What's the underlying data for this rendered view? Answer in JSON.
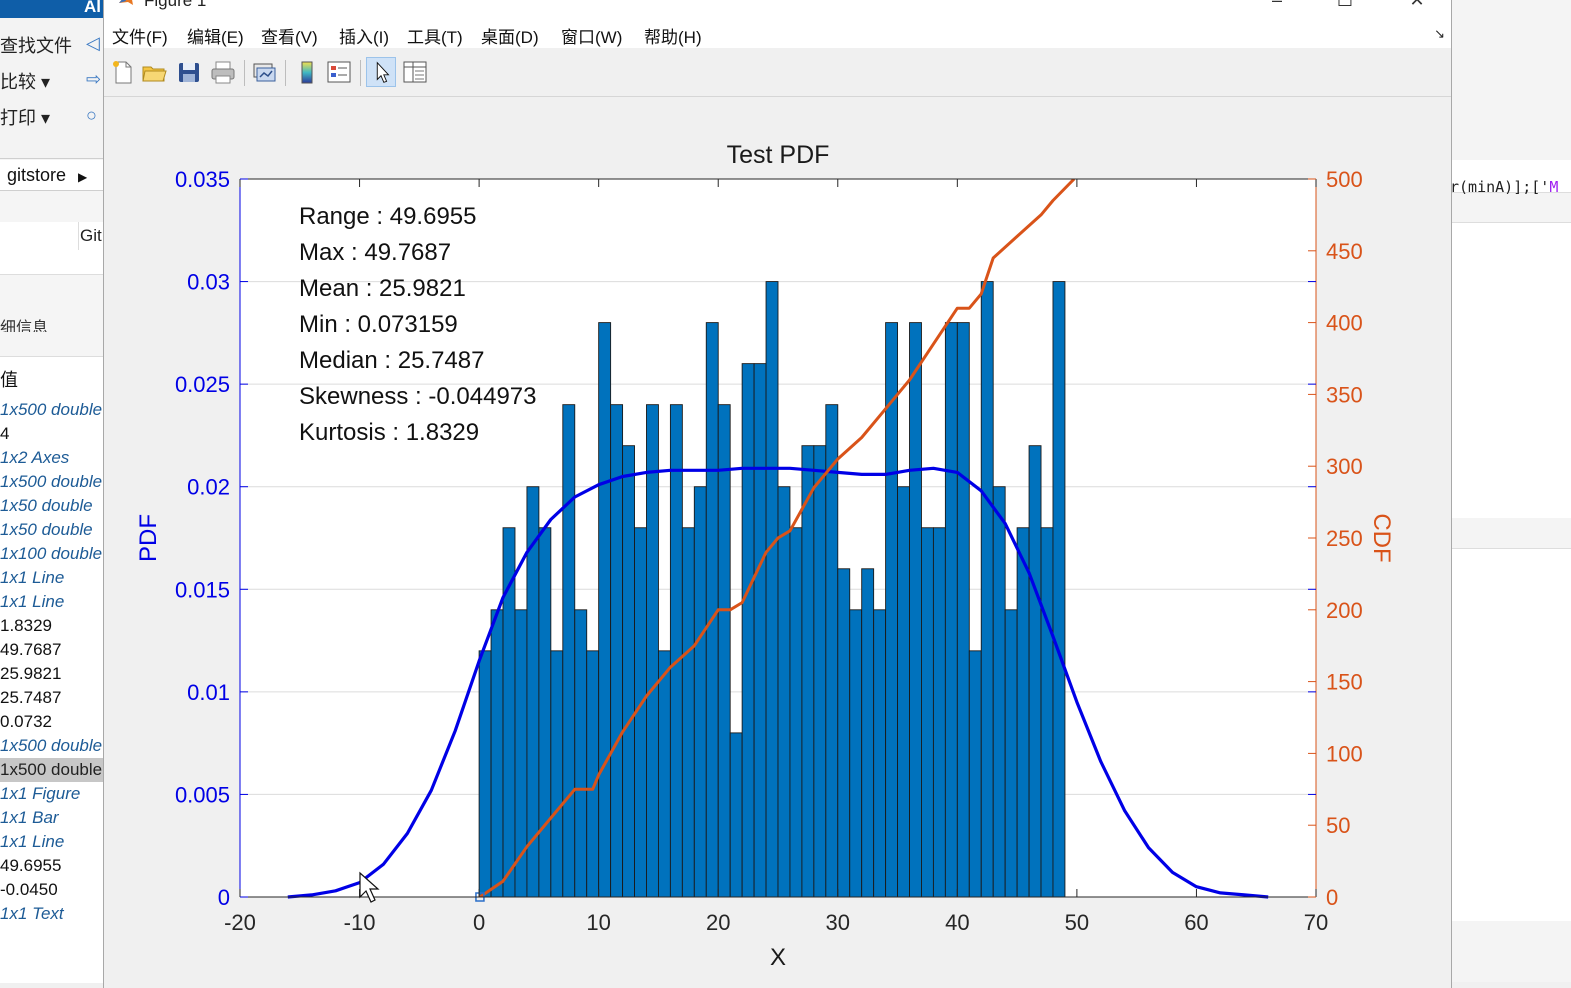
{
  "background": {
    "app_title_fragment": "Al",
    "ribbon_items": [
      "查找文件",
      "比较",
      "打印"
    ],
    "breadcrumb": "gitstore",
    "column_fragment": "Git",
    "section_fragment": "细信息",
    "value_header": "值",
    "workspace_values": [
      {
        "text": "1x500 double",
        "style": "link"
      },
      {
        "text": "4",
        "style": "plain"
      },
      {
        "text": "1x2 Axes",
        "style": "link"
      },
      {
        "text": "1x500 double",
        "style": "link"
      },
      {
        "text": "1x50 double",
        "style": "link"
      },
      {
        "text": "1x50 double",
        "style": "link"
      },
      {
        "text": "1x100 double",
        "style": "link"
      },
      {
        "text": "1x1 Line",
        "style": "link"
      },
      {
        "text": "1x1 Line",
        "style": "link"
      },
      {
        "text": "1.8329",
        "style": "plain"
      },
      {
        "text": "49.7687",
        "style": "plain"
      },
      {
        "text": "25.9821",
        "style": "plain"
      },
      {
        "text": "25.7487",
        "style": "plain"
      },
      {
        "text": "0.0732",
        "style": "plain"
      },
      {
        "text": "1x500 double",
        "style": "link"
      },
      {
        "text": "1x500 double",
        "style": "selected"
      },
      {
        "text": "1x1 Figure",
        "style": "link"
      },
      {
        "text": "1x1 Bar",
        "style": "link"
      },
      {
        "text": "1x1 Line",
        "style": "link"
      },
      {
        "text": "49.6955",
        "style": "plain"
      },
      {
        "text": "-0.0450",
        "style": "plain"
      },
      {
        "text": "1x1 Text",
        "style": "link"
      }
    ],
    "code_fragment_prefix": "r(minA)];['",
    "code_fragment_string": "M"
  },
  "figure": {
    "title": "Figure 1",
    "menu": [
      "文件(F)",
      "编辑(E)",
      "查看(V)",
      "插入(I)",
      "工具(T)",
      "桌面(D)",
      "窗口(W)",
      "帮助(H)"
    ],
    "toolbar_icons": [
      "new-figure-icon",
      "open-file-icon",
      "save-icon",
      "print-icon",
      "link-plot-icon",
      "colorbar-icon",
      "legend-icon",
      "edit-plot-icon",
      "property-inspector-icon"
    ]
  },
  "chart_data": {
    "type": "bar",
    "title": "Test PDF",
    "xlabel": "X",
    "ylabel_left": "PDF",
    "ylabel_right": "CDF",
    "xlim": [
      -20,
      70
    ],
    "ylim_left": [
      0,
      0.035
    ],
    "ylim_right": [
      0,
      500
    ],
    "xticks": [
      "-20",
      "-10",
      "0",
      "10",
      "20",
      "30",
      "40",
      "50",
      "60",
      "70"
    ],
    "yticks_left": [
      "0",
      "0.005",
      "0.01",
      "0.015",
      "0.02",
      "0.025",
      "0.03",
      "0.035"
    ],
    "yticks_right": [
      "0",
      "50",
      "100",
      "150",
      "200",
      "250",
      "300",
      "350",
      "400",
      "450",
      "500"
    ],
    "grid": true,
    "colors": {
      "bars": "#0072bd",
      "pdf_line": "#0000e6",
      "cdf_line": "#d95319",
      "left_axis": "#0000e6",
      "right_axis": "#d95319"
    },
    "histogram": {
      "bin_start": 0,
      "bin_width": 1,
      "values": [
        0.012,
        0.014,
        0.018,
        0.014,
        0.02,
        0.018,
        0.012,
        0.024,
        0.014,
        0.012,
        0.028,
        0.024,
        0.022,
        0.018,
        0.024,
        0.012,
        0.024,
        0.018,
        0.02,
        0.028,
        0.024,
        0.008,
        0.026,
        0.026,
        0.03,
        0.02,
        0.018,
        0.022,
        0.022,
        0.024,
        0.016,
        0.014,
        0.016,
        0.014,
        0.028,
        0.02,
        0.028,
        0.018,
        0.018,
        0.028,
        0.028,
        0.012,
        0.03,
        0.02,
        0.014,
        0.018,
        0.022,
        0.018,
        0.03
      ]
    },
    "pdf_curve": {
      "x": [
        -16,
        -14,
        -12,
        -10,
        -8,
        -6,
        -4,
        -2,
        0,
        2,
        4,
        6,
        8,
        10,
        12,
        14,
        16,
        18,
        20,
        22,
        24,
        26,
        28,
        30,
        32,
        34,
        36,
        38,
        40,
        42,
        44,
        46,
        48,
        50,
        52,
        54,
        56,
        58,
        60,
        62,
        64,
        66
      ],
      "y": [
        0.0,
        0.0001,
        0.0003,
        0.0007,
        0.0016,
        0.0031,
        0.0052,
        0.0081,
        0.0115,
        0.0146,
        0.0168,
        0.0184,
        0.0195,
        0.0201,
        0.0205,
        0.0207,
        0.0208,
        0.0208,
        0.0208,
        0.0209,
        0.0209,
        0.0209,
        0.0208,
        0.0207,
        0.0206,
        0.0206,
        0.0208,
        0.0209,
        0.0207,
        0.0198,
        0.0182,
        0.0158,
        0.0127,
        0.0095,
        0.0066,
        0.0042,
        0.0024,
        0.0012,
        0.0005,
        0.0002,
        0.0001,
        0.0
      ]
    },
    "cdf_curve": {
      "x": [
        0.07,
        2,
        4,
        6,
        8,
        9.5,
        10,
        12,
        14,
        16,
        18,
        20,
        21,
        22,
        24,
        25,
        26,
        28,
        30,
        32,
        34,
        36,
        38,
        40,
        41,
        42,
        43,
        45,
        47,
        48,
        49.77
      ],
      "y": [
        0,
        11,
        35,
        55,
        75,
        75,
        85,
        115,
        140,
        160,
        175,
        200,
        200,
        205,
        240,
        250,
        255,
        285,
        305,
        320,
        340,
        360,
        385,
        410,
        410,
        420,
        445,
        460,
        475,
        485,
        500
      ]
    },
    "annotations": [
      "Range : 49.6955",
      "Max : 49.7687",
      "Mean : 25.9821",
      "Min : 0.073159",
      "Median : 25.7487",
      "Skewness : -0.044973",
      "Kurtosis : 1.8329"
    ]
  }
}
